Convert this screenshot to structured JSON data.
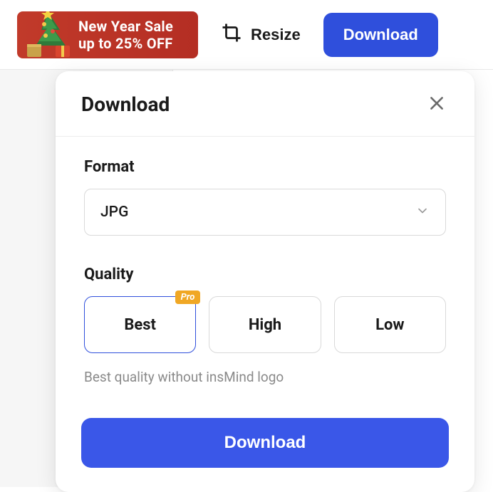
{
  "toolbar": {
    "promo": {
      "line1": "New Year Sale",
      "line2": "up to 25% OFF"
    },
    "resize_label": "Resize",
    "download_label": "Download"
  },
  "dialog": {
    "title": "Download",
    "format": {
      "label": "Format",
      "selected": "JPG"
    },
    "quality": {
      "label": "Quality",
      "options": [
        {
          "label": "Best",
          "badge": "Pro",
          "selected": true
        },
        {
          "label": "High",
          "selected": false
        },
        {
          "label": "Low",
          "selected": false
        }
      ],
      "note": "Best quality without insMind logo"
    },
    "action": "Download"
  }
}
